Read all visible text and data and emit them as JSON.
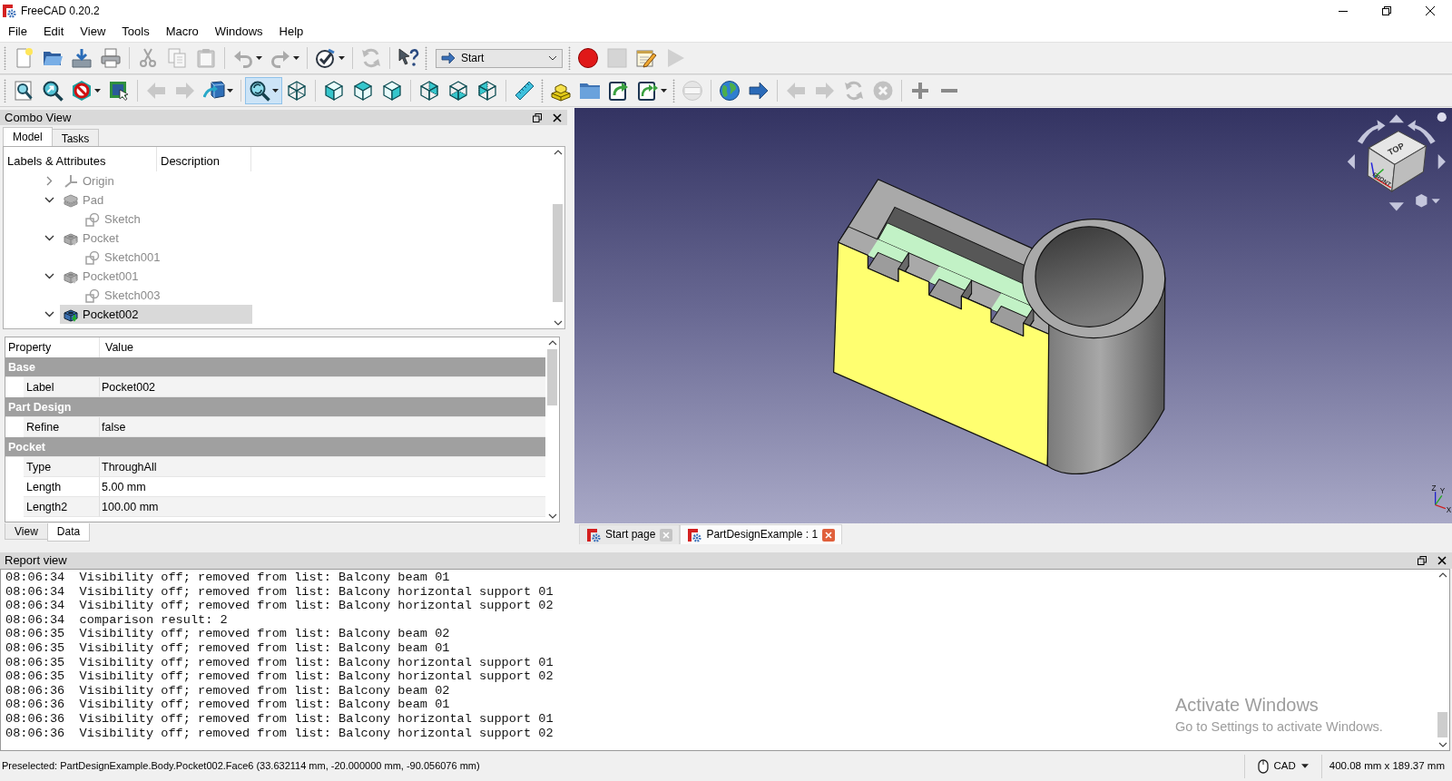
{
  "window": {
    "title": "FreeCAD 0.20.2"
  },
  "menu": [
    "File",
    "Edit",
    "View",
    "Tools",
    "Macro",
    "Windows",
    "Help"
  ],
  "toolbar_rows": [
    [
      {
        "kind": "buttons",
        "groups": [
          [
            {
              "disabled": false,
              "pressed": false,
              "dropdown": false
            },
            {
              "disabled": false,
              "pressed": false,
              "dropdown": false
            },
            {
              "disabled": false,
              "pressed": false,
              "dropdown": false
            },
            {
              "disabled": false,
              "pressed": false,
              "dropdown": false
            }
          ],
          [
            {
              "disabled": true,
              "pressed": false,
              "dropdown": false
            },
            {
              "disabled": true,
              "pressed": false,
              "dropdown": false
            },
            {
              "disabled": true,
              "pressed": false,
              "dropdown": false
            }
          ],
          [
            {
              "disabled": true,
              "pressed": false,
              "dropdown": true
            },
            {
              "disabled": true,
              "pressed": false,
              "dropdown": true
            }
          ],
          [
            {
              "disabled": false,
              "pressed": false,
              "dropdown": true
            }
          ],
          [
            {
              "disabled": true,
              "pressed": false,
              "dropdown": false
            }
          ],
          [
            {
              "disabled": false,
              "pressed": false,
              "dropdown": false
            }
          ]
        ]
      },
      {
        "kind": "selector",
        "value": "Start"
      },
      {
        "kind": "buttons",
        "groups": [
          [
            {
              "disabled": false,
              "pressed": false,
              "dropdown": false
            },
            {
              "disabled": true,
              "pressed": false,
              "dropdown": false
            },
            {
              "disabled": false,
              "pressed": false,
              "dropdown": false
            },
            {
              "disabled": true,
              "pressed": false,
              "dropdown": false
            }
          ]
        ]
      }
    ],
    [
      {
        "kind": "buttons",
        "groups": [
          [
            {
              "disabled": false,
              "pressed": false,
              "dropdown": false
            },
            {
              "disabled": false,
              "pressed": false,
              "dropdown": false
            },
            {
              "disabled": false,
              "pressed": false,
              "dropdown": true
            },
            {
              "disabled": false,
              "pressed": false,
              "dropdown": false
            }
          ],
          [
            {
              "disabled": true,
              "pressed": false,
              "dropdown": false
            },
            {
              "disabled": true,
              "pressed": false,
              "dropdown": false
            },
            {
              "disabled": false,
              "pressed": false,
              "dropdown": true
            }
          ],
          [
            {
              "disabled": false,
              "pressed": true,
              "dropdown": true
            },
            {
              "disabled": false,
              "pressed": false,
              "dropdown": false
            }
          ],
          [
            {
              "disabled": false,
              "pressed": false,
              "dropdown": false
            },
            {
              "disabled": false,
              "pressed": false,
              "dropdown": false
            },
            {
              "disabled": false,
              "pressed": false,
              "dropdown": false
            }
          ],
          [
            {
              "disabled": false,
              "pressed": false,
              "dropdown": false
            },
            {
              "disabled": false,
              "pressed": false,
              "dropdown": false
            },
            {
              "disabled": false,
              "pressed": false,
              "dropdown": false
            }
          ],
          [
            {
              "disabled": false,
              "pressed": false,
              "dropdown": false
            }
          ]
        ]
      },
      {
        "kind": "buttons",
        "groups": [
          [
            {
              "disabled": false,
              "pressed": false,
              "dropdown": false
            },
            {
              "disabled": false,
              "pressed": false,
              "dropdown": false
            },
            {
              "disabled": false,
              "pressed": false,
              "dropdown": false
            },
            {
              "disabled": false,
              "pressed": false,
              "dropdown": true
            }
          ]
        ]
      },
      {
        "kind": "buttons",
        "groups": [
          [
            {
              "disabled": true,
              "pressed": false,
              "dropdown": false
            }
          ],
          [
            {
              "disabled": false,
              "pressed": false,
              "dropdown": false
            },
            {
              "disabled": false,
              "pressed": false,
              "dropdown": false
            }
          ],
          [
            {
              "disabled": true,
              "pressed": false,
              "dropdown": false
            },
            {
              "disabled": true,
              "pressed": false,
              "dropdown": false
            },
            {
              "disabled": true,
              "pressed": false,
              "dropdown": false
            },
            {
              "disabled": true,
              "pressed": false,
              "dropdown": false
            }
          ],
          [
            {
              "disabled": false,
              "pressed": false,
              "dropdown": false
            },
            {
              "disabled": false,
              "pressed": false,
              "dropdown": false
            }
          ]
        ]
      }
    ]
  ],
  "combo_view": {
    "title": "Combo View",
    "tabs": [
      {
        "label": "Model",
        "selected": true
      },
      {
        "label": "Tasks",
        "selected": false
      }
    ],
    "tree": {
      "columns": [
        "Labels & Attributes",
        "Description"
      ],
      "items": [
        {
          "kind": "origin",
          "label": "Origin",
          "expanded": false,
          "dimmed": true,
          "selected": false
        },
        {
          "kind": "pad",
          "label": "Pad",
          "expanded": true,
          "dimmed": true,
          "selected": false,
          "children": [
            {
              "kind": "sketch",
              "label": "Sketch",
              "dimmed": true,
              "selected": false
            }
          ]
        },
        {
          "kind": "pocket",
          "label": "Pocket",
          "expanded": true,
          "dimmed": true,
          "selected": false,
          "children": [
            {
              "kind": "sketch",
              "label": "Sketch001",
              "dimmed": true,
              "selected": false
            }
          ]
        },
        {
          "kind": "pocket",
          "label": "Pocket001",
          "expanded": true,
          "dimmed": true,
          "selected": false,
          "children": [
            {
              "kind": "sketch",
              "label": "Sketch003",
              "dimmed": true,
              "selected": false
            }
          ]
        },
        {
          "kind": "pocket",
          "label": "Pocket002",
          "expanded": true,
          "dimmed": false,
          "selected": true
        }
      ]
    },
    "properties": {
      "columns": [
        "Property",
        "Value"
      ],
      "groups": [
        {
          "name": "Base",
          "rows": [
            {
              "name": "Label",
              "value": "Pocket002"
            }
          ]
        },
        {
          "name": "Part Design",
          "rows": [
            {
              "name": "Refine",
              "value": "false"
            }
          ]
        },
        {
          "name": "Pocket",
          "rows": [
            {
              "name": "Type",
              "value": "ThroughAll"
            },
            {
              "name": "Length",
              "value": "5.00 mm"
            },
            {
              "name": "Length2",
              "value": "100.00 mm"
            }
          ]
        }
      ]
    },
    "property_tabs": [
      {
        "label": "View",
        "selected": false
      },
      {
        "label": "Data",
        "selected": true
      }
    ]
  },
  "viewport": {
    "cube_labels": [
      "TOP",
      "FRONT"
    ],
    "axis_labels": [
      "Z",
      "Y",
      "X"
    ]
  },
  "document_tabs": [
    {
      "label": "Start page",
      "selected": false
    },
    {
      "label": "PartDesignExample : 1",
      "selected": true
    }
  ],
  "report_view": {
    "title": "Report view",
    "lines": [
      "08:06:34  Visibility off; removed from list: Balcony beam 01",
      "08:06:34  Visibility off; removed from list: Balcony horizontal support 01",
      "08:06:34  Visibility off; removed from list: Balcony horizontal support 02",
      "08:06:34  comparison result: 2",
      "08:06:35  Visibility off; removed from list: Balcony beam 02",
      "08:06:35  Visibility off; removed from list: Balcony beam 01",
      "08:06:35  Visibility off; removed from list: Balcony horizontal support 01",
      "08:06:35  Visibility off; removed from list: Balcony horizontal support 02",
      "08:06:36  Visibility off; removed from list: Balcony beam 02",
      "08:06:36  Visibility off; removed from list: Balcony beam 01",
      "08:06:36  Visibility off; removed from list: Balcony horizontal support 01",
      "08:06:36  Visibility off; removed from list: Balcony horizontal support 02"
    ]
  },
  "status_bar": {
    "message": "Preselected: PartDesignExample.Body.Pocket002.Face6 (33.632114 mm, -20.000000 mm, -90.056076 mm)",
    "navigation_style": "CAD",
    "dimensions": "400.08 mm x 189.37 mm"
  },
  "windows_activation_notice": {
    "title": "Activate Windows",
    "text": "Go to Settings to activate Windows."
  }
}
